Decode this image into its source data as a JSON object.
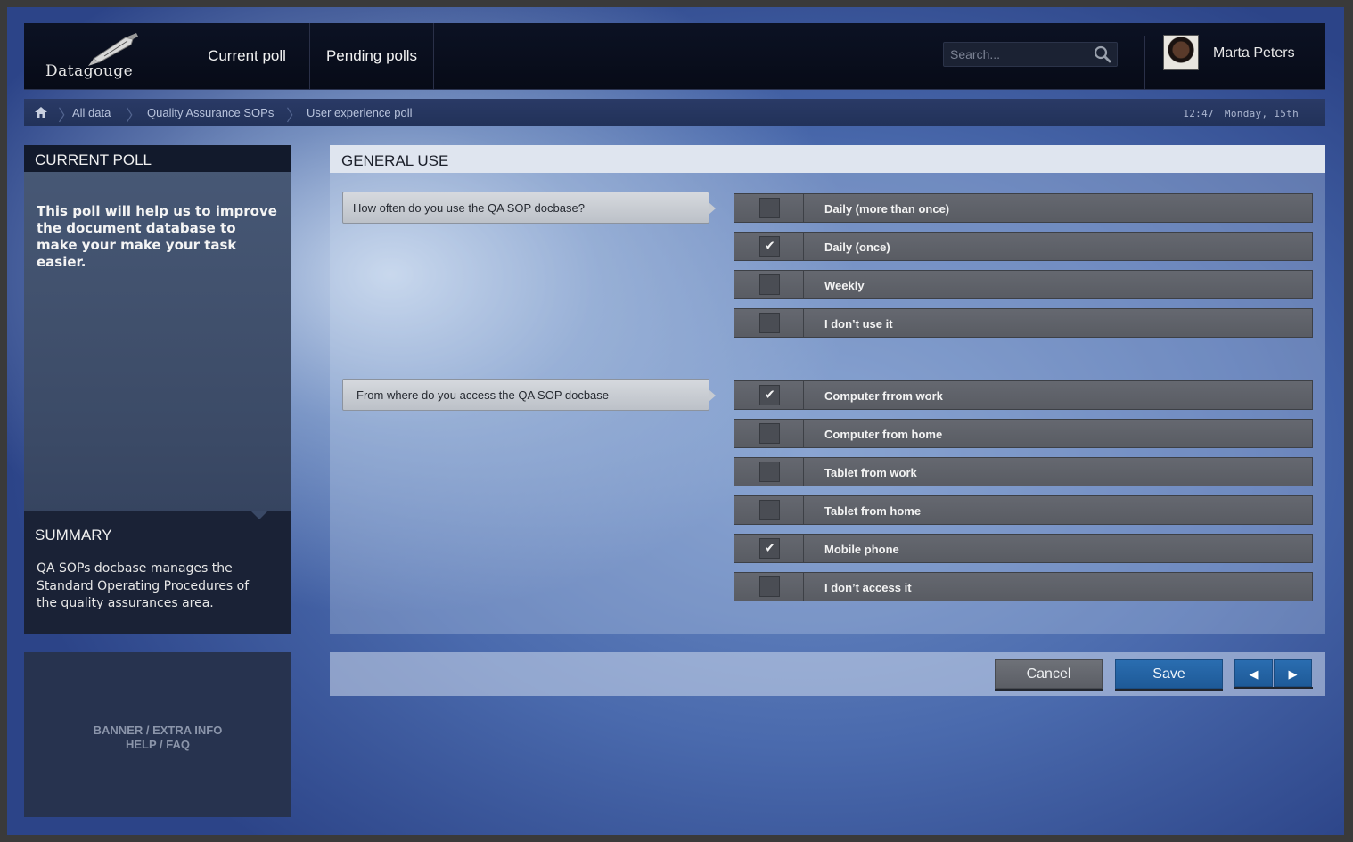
{
  "app": {
    "name": "Datagouge"
  },
  "nav": {
    "tabs": [
      {
        "label": "Current poll"
      },
      {
        "label": "Pending polls"
      }
    ]
  },
  "search": {
    "placeholder": "Search..."
  },
  "user": {
    "name": "Marta Peters"
  },
  "breadcrumb": {
    "items": [
      "All data",
      "Quality Assurance SOPs",
      "User experience poll"
    ]
  },
  "clock": {
    "time": "12:47",
    "date": "Monday, 15th"
  },
  "sidebar": {
    "current_poll_title": "CURRENT POLL",
    "current_poll_text": "This poll will help us to improve the document database to make your make your task easier.",
    "summary_title": "SUMMARY",
    "summary_text": "QA SOPs docbase manages the Standard Operating Procedures of the quality assurances area.",
    "banner_line1": "BANNER / EXTRA INFO",
    "banner_line2": "HELP / FAQ"
  },
  "main": {
    "section_title": "GENERAL USE",
    "questions": [
      {
        "text": "How often do you use the QA SOP docbase?",
        "options": [
          {
            "label": "Daily (more than once)",
            "checked": false
          },
          {
            "label": "Daily (once)",
            "checked": true
          },
          {
            "label": "Weekly",
            "checked": false
          },
          {
            "label": "I don’t use it",
            "checked": false
          }
        ]
      },
      {
        "text": "From where do you access the QA SOP docbase",
        "options": [
          {
            "label": "Computer frrom work",
            "checked": true
          },
          {
            "label": "Computer from home",
            "checked": false
          },
          {
            "label": "Tablet from work",
            "checked": false
          },
          {
            "label": "Tablet from home",
            "checked": false
          },
          {
            "label": "Mobile phone",
            "checked": true
          },
          {
            "label": "I don’t access it",
            "checked": false
          }
        ]
      }
    ]
  },
  "actions": {
    "cancel": "Cancel",
    "save": "Save",
    "prev": "◀",
    "next": "▶"
  },
  "colors": {
    "accent": "#1f5e9e",
    "header_bg": "#0a0f1e",
    "option_bg": "#5f6268"
  },
  "icons": {
    "home": "home-icon",
    "search": "search-icon",
    "check": "✔"
  }
}
